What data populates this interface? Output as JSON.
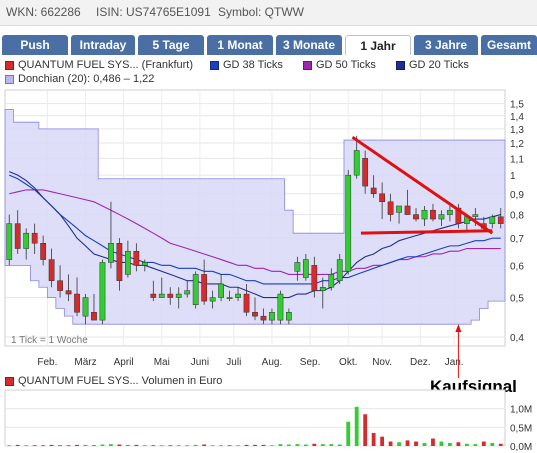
{
  "info": {
    "wkn": "WKN: 662286",
    "isin": "ISIN: US74765E1091",
    "symbol": "Symbol: QTWW"
  },
  "tabs": [
    "Push",
    "Intraday",
    "5 Tage",
    "1 Monat",
    "3 Monate",
    "1 Jahr",
    "3 Jahre",
    "Gesamt"
  ],
  "active_tab": "1 Jahr",
  "legend": {
    "price": "QUANTUM FUEL SYS... (Frankfurt)",
    "gd38": "GD 38 Ticks",
    "gd50": "GD 50 Ticks",
    "gd20": "GD 20 Ticks",
    "donchian": "Donchian (20): 0,486 – 1,22"
  },
  "colors": {
    "tab_bg": "#4a6fa5",
    "up": "#33cc33",
    "down": "#d42b2b",
    "gd38": "#1a3fbf",
    "gd50": "#9c27b0",
    "gd20": "#1f2f8f",
    "donchian_fill": "#d8d8f8",
    "donchian_line": "#8888dd",
    "trend": "#e01010"
  },
  "tick_note": "1 Tick = 1 Woche",
  "annotation": "Kaufsignal",
  "volume_legend": "QUANTUM FUEL SYS... Volumen in Euro",
  "chart_data": {
    "type": "candlestick",
    "y_scale": "log",
    "ylim": [
      0.38,
      1.62
    ],
    "y_ticks": [
      {
        "v": 1.5,
        "label": "1,5"
      },
      {
        "v": 1.4,
        "label": "1,4"
      },
      {
        "v": 1.3,
        "label": "1,3"
      },
      {
        "v": 1.2,
        "label": "1,2"
      },
      {
        "v": 1.1,
        "label": "1,1"
      },
      {
        "v": 1.0,
        "label": "1"
      },
      {
        "v": 0.9,
        "label": "0,9"
      },
      {
        "v": 0.8,
        "label": "0,8"
      },
      {
        "v": 0.7,
        "label": "0,7"
      },
      {
        "v": 0.6,
        "label": "0,6"
      },
      {
        "v": 0.5,
        "label": "0,5"
      },
      {
        "v": 0.4,
        "label": "0,4"
      }
    ],
    "x_labels": [
      {
        "i": 4.5,
        "label": "Feb."
      },
      {
        "i": 9,
        "label": "März"
      },
      {
        "i": 13.5,
        "label": "April"
      },
      {
        "i": 18,
        "label": "Mai"
      },
      {
        "i": 22.5,
        "label": "Juni"
      },
      {
        "i": 26.5,
        "label": "Juli"
      },
      {
        "i": 31,
        "label": "Aug."
      },
      {
        "i": 35.5,
        "label": "Sep."
      },
      {
        "i": 40,
        "label": "Okt."
      },
      {
        "i": 44,
        "label": "Nov."
      },
      {
        "i": 48.5,
        "label": "Dez."
      },
      {
        "i": 52.5,
        "label": "Jan."
      }
    ],
    "candles": [
      {
        "o": 0.62,
        "h": 0.8,
        "l": 0.6,
        "c": 0.76
      },
      {
        "o": 0.76,
        "h": 0.82,
        "l": 0.64,
        "c": 0.66
      },
      {
        "o": 0.66,
        "h": 0.74,
        "l": 0.62,
        "c": 0.72
      },
      {
        "o": 0.72,
        "h": 0.76,
        "l": 0.64,
        "c": 0.68
      },
      {
        "o": 0.68,
        "h": 0.71,
        "l": 0.6,
        "c": 0.62
      },
      {
        "o": 0.62,
        "h": 0.66,
        "l": 0.53,
        "c": 0.55
      },
      {
        "o": 0.55,
        "h": 0.6,
        "l": 0.5,
        "c": 0.52
      },
      {
        "o": 0.52,
        "h": 0.57,
        "l": 0.49,
        "c": 0.51
      },
      {
        "o": 0.51,
        "h": 0.56,
        "l": 0.45,
        "c": 0.46
      },
      {
        "o": 0.45,
        "h": 0.51,
        "l": 0.43,
        "c": 0.5
      },
      {
        "o": 0.46,
        "h": 0.51,
        "l": 0.44,
        "c": 0.44
      },
      {
        "o": 0.44,
        "h": 0.62,
        "l": 0.43,
        "c": 0.61
      },
      {
        "o": 0.61,
        "h": 0.86,
        "l": 0.59,
        "c": 0.68
      },
      {
        "o": 0.68,
        "h": 0.7,
        "l": 0.52,
        "c": 0.55
      },
      {
        "o": 0.57,
        "h": 0.69,
        "l": 0.56,
        "c": 0.65
      },
      {
        "o": 0.65,
        "h": 0.68,
        "l": 0.58,
        "c": 0.6
      },
      {
        "o": 0.6,
        "h": 0.62,
        "l": 0.58,
        "c": 0.61
      },
      {
        "o": 0.51,
        "h": 0.55,
        "l": 0.49,
        "c": 0.5
      },
      {
        "o": 0.5,
        "h": 0.56,
        "l": 0.5,
        "c": 0.51
      },
      {
        "o": 0.51,
        "h": 0.53,
        "l": 0.48,
        "c": 0.5
      },
      {
        "o": 0.5,
        "h": 0.53,
        "l": 0.47,
        "c": 0.51
      },
      {
        "o": 0.51,
        "h": 0.55,
        "l": 0.5,
        "c": 0.52
      },
      {
        "o": 0.48,
        "h": 0.58,
        "l": 0.47,
        "c": 0.57
      },
      {
        "o": 0.57,
        "h": 0.62,
        "l": 0.48,
        "c": 0.49
      },
      {
        "o": 0.49,
        "h": 0.52,
        "l": 0.47,
        "c": 0.5
      },
      {
        "o": 0.5,
        "h": 0.57,
        "l": 0.49,
        "c": 0.54
      },
      {
        "o": 0.5,
        "h": 0.52,
        "l": 0.49,
        "c": 0.5
      },
      {
        "o": 0.5,
        "h": 0.53,
        "l": 0.49,
        "c": 0.51
      },
      {
        "o": 0.51,
        "h": 0.54,
        "l": 0.45,
        "c": 0.46
      },
      {
        "o": 0.46,
        "h": 0.5,
        "l": 0.44,
        "c": 0.45
      },
      {
        "o": 0.45,
        "h": 0.47,
        "l": 0.43,
        "c": 0.44
      },
      {
        "o": 0.44,
        "h": 0.47,
        "l": 0.43,
        "c": 0.46
      },
      {
        "o": 0.44,
        "h": 0.52,
        "l": 0.43,
        "c": 0.51
      },
      {
        "o": 0.44,
        "h": 0.47,
        "l": 0.43,
        "c": 0.46
      },
      {
        "o": 0.58,
        "h": 0.63,
        "l": 0.55,
        "c": 0.61
      },
      {
        "o": 0.56,
        "h": 0.64,
        "l": 0.55,
        "c": 0.62
      },
      {
        "o": 0.6,
        "h": 0.63,
        "l": 0.5,
        "c": 0.52
      },
      {
        "o": 0.52,
        "h": 0.56,
        "l": 0.47,
        "c": 0.53
      },
      {
        "o": 0.53,
        "h": 0.59,
        "l": 0.52,
        "c": 0.57
      },
      {
        "o": 0.55,
        "h": 0.64,
        "l": 0.54,
        "c": 0.62
      },
      {
        "o": 0.58,
        "h": 1.03,
        "l": 0.57,
        "c": 1.0
      },
      {
        "o": 1.0,
        "h": 1.25,
        "l": 0.98,
        "c": 1.15
      },
      {
        "o": 1.1,
        "h": 1.15,
        "l": 0.9,
        "c": 0.94
      },
      {
        "o": 0.93,
        "h": 1.0,
        "l": 0.88,
        "c": 0.9
      },
      {
        "o": 0.9,
        "h": 0.96,
        "l": 0.78,
        "c": 0.86
      },
      {
        "o": 0.86,
        "h": 0.9,
        "l": 0.77,
        "c": 0.8
      },
      {
        "o": 0.81,
        "h": 0.84,
        "l": 0.76,
        "c": 0.84
      },
      {
        "o": 0.84,
        "h": 0.92,
        "l": 0.8,
        "c": 0.8
      },
      {
        "o": 0.8,
        "h": 0.83,
        "l": 0.77,
        "c": 0.78
      },
      {
        "o": 0.78,
        "h": 0.84,
        "l": 0.75,
        "c": 0.82
      },
      {
        "o": 0.82,
        "h": 0.85,
        "l": 0.77,
        "c": 0.78
      },
      {
        "o": 0.78,
        "h": 0.82,
        "l": 0.75,
        "c": 0.8
      },
      {
        "o": 0.8,
        "h": 0.84,
        "l": 0.77,
        "c": 0.82
      },
      {
        "o": 0.83,
        "h": 0.85,
        "l": 0.74,
        "c": 0.76
      },
      {
        "o": 0.76,
        "h": 0.8,
        "l": 0.73,
        "c": 0.79
      },
      {
        "o": 0.79,
        "h": 0.83,
        "l": 0.75,
        "c": 0.8
      },
      {
        "o": 0.76,
        "h": 0.79,
        "l": 0.73,
        "c": 0.74
      },
      {
        "o": 0.76,
        "h": 0.8,
        "l": 0.74,
        "c": 0.79
      },
      {
        "o": 0.79,
        "h": 0.83,
        "l": 0.74,
        "c": 0.76
      }
    ],
    "donchian_upper": [
      1.45,
      1.35,
      1.35,
      1.35,
      1.3,
      1.3,
      1.3,
      1.3,
      1.3,
      1.3,
      1.3,
      0.98,
      0.98,
      0.98,
      0.98,
      0.98,
      0.98,
      0.98,
      0.98,
      0.98,
      0.98,
      0.98,
      0.98,
      0.98,
      0.98,
      0.98,
      0.98,
      0.98,
      0.98,
      0.98,
      0.98,
      0.98,
      0.98,
      0.82,
      0.72,
      0.72,
      0.72,
      0.72,
      0.72,
      0.72,
      1.22,
      1.22,
      1.22,
      1.22,
      1.22,
      1.22,
      1.22,
      1.22,
      1.22,
      1.22,
      1.22,
      1.22,
      1.22,
      1.22,
      1.22,
      1.22,
      1.22,
      1.22,
      1.22
    ],
    "donchian_lower": [
      0.6,
      0.6,
      0.6,
      0.55,
      0.53,
      0.5,
      0.47,
      0.45,
      0.43,
      0.43,
      0.43,
      0.43,
      0.43,
      0.43,
      0.43,
      0.43,
      0.43,
      0.43,
      0.43,
      0.43,
      0.43,
      0.43,
      0.43,
      0.43,
      0.43,
      0.43,
      0.43,
      0.43,
      0.43,
      0.43,
      0.43,
      0.43,
      0.43,
      0.43,
      0.43,
      0.43,
      0.43,
      0.43,
      0.43,
      0.43,
      0.43,
      0.43,
      0.43,
      0.43,
      0.43,
      0.43,
      0.43,
      0.43,
      0.43,
      0.43,
      0.43,
      0.43,
      0.43,
      0.43,
      0.43,
      0.44,
      0.47,
      0.49,
      0.49
    ],
    "gd20": [
      1.02,
      1.0,
      0.97,
      0.93,
      0.88,
      0.84,
      0.8,
      0.75,
      0.7,
      0.67,
      0.64,
      0.63,
      0.62,
      0.61,
      0.61,
      0.6,
      0.6,
      0.59,
      0.58,
      0.57,
      0.56,
      0.55,
      0.55,
      0.54,
      0.54,
      0.54,
      0.53,
      0.53,
      0.52,
      0.51,
      0.5,
      0.5,
      0.5,
      0.5,
      0.51,
      0.51,
      0.52,
      0.52,
      0.53,
      0.55,
      0.58,
      0.61,
      0.63,
      0.64,
      0.66,
      0.67,
      0.69,
      0.7,
      0.71,
      0.72,
      0.73,
      0.74,
      0.75,
      0.76,
      0.77,
      0.78,
      0.78,
      0.79,
      0.8
    ],
    "gd38": [
      1.0,
      0.98,
      0.95,
      0.92,
      0.88,
      0.84,
      0.8,
      0.77,
      0.74,
      0.71,
      0.69,
      0.67,
      0.65,
      0.64,
      0.63,
      0.62,
      0.61,
      0.61,
      0.6,
      0.6,
      0.59,
      0.59,
      0.59,
      0.58,
      0.58,
      0.57,
      0.57,
      0.56,
      0.55,
      0.55,
      0.54,
      0.54,
      0.54,
      0.54,
      0.54,
      0.54,
      0.54,
      0.55,
      0.55,
      0.56,
      0.56,
      0.57,
      0.58,
      0.59,
      0.6,
      0.61,
      0.62,
      0.63,
      0.63,
      0.64,
      0.65,
      0.66,
      0.67,
      0.67,
      0.68,
      0.69,
      0.69,
      0.7,
      0.7
    ],
    "gd50": [
      0.9,
      0.91,
      0.92,
      0.92,
      0.92,
      0.91,
      0.9,
      0.89,
      0.88,
      0.87,
      0.86,
      0.84,
      0.82,
      0.8,
      0.78,
      0.76,
      0.74,
      0.72,
      0.7,
      0.68,
      0.67,
      0.66,
      0.65,
      0.64,
      0.63,
      0.62,
      0.61,
      0.6,
      0.6,
      0.59,
      0.59,
      0.58,
      0.58,
      0.57,
      0.57,
      0.57,
      0.57,
      0.57,
      0.57,
      0.58,
      0.58,
      0.59,
      0.59,
      0.6,
      0.6,
      0.61,
      0.62,
      0.62,
      0.63,
      0.63,
      0.64,
      0.64,
      0.65,
      0.65,
      0.66,
      0.66,
      0.66,
      0.66,
      0.66
    ],
    "trendline_upper": [
      {
        "i": 40.5,
        "v": 1.24
      },
      {
        "i": 57,
        "v": 0.72
      }
    ],
    "trendline_lower": [
      {
        "i": 41.5,
        "v": 0.72
      },
      {
        "i": 57,
        "v": 0.73
      }
    ],
    "arrow_index": 53,
    "volume": {
      "y_ticks": [
        {
          "v": 0,
          "label": "0,0M"
        },
        {
          "v": 0.5,
          "label": "0,5M"
        },
        {
          "v": 1.0,
          "label": "1,0M"
        }
      ],
      "ylim": [
        0,
        1.5
      ],
      "values": [
        0.02,
        0.03,
        0.02,
        0.02,
        0.02,
        0.03,
        0.02,
        0.02,
        0.03,
        0.03,
        0.02,
        0.04,
        0.05,
        0.04,
        0.03,
        0.03,
        0.02,
        0.02,
        0.02,
        0.02,
        0.02,
        0.02,
        0.03,
        0.04,
        0.02,
        0.02,
        0.02,
        0.02,
        0.03,
        0.03,
        0.03,
        0.02,
        0.05,
        0.04,
        0.05,
        0.04,
        0.06,
        0.05,
        0.05,
        0.04,
        0.65,
        1.05,
        0.85,
        0.35,
        0.25,
        0.12,
        0.1,
        0.15,
        0.12,
        0.08,
        0.2,
        0.12,
        0.08,
        0.1,
        0.06,
        0.05,
        0.12,
        0.08,
        0.06
      ],
      "up": [
        true,
        false,
        true,
        false,
        false,
        false,
        false,
        false,
        false,
        true,
        false,
        true,
        true,
        false,
        true,
        false,
        true,
        false,
        true,
        false,
        true,
        true,
        true,
        false,
        true,
        true,
        false,
        true,
        false,
        false,
        false,
        true,
        true,
        true,
        true,
        true,
        false,
        true,
        true,
        true,
        true,
        true,
        false,
        false,
        false,
        false,
        true,
        false,
        false,
        true,
        false,
        true,
        true,
        false,
        true,
        true,
        false,
        true,
        false
      ]
    }
  }
}
